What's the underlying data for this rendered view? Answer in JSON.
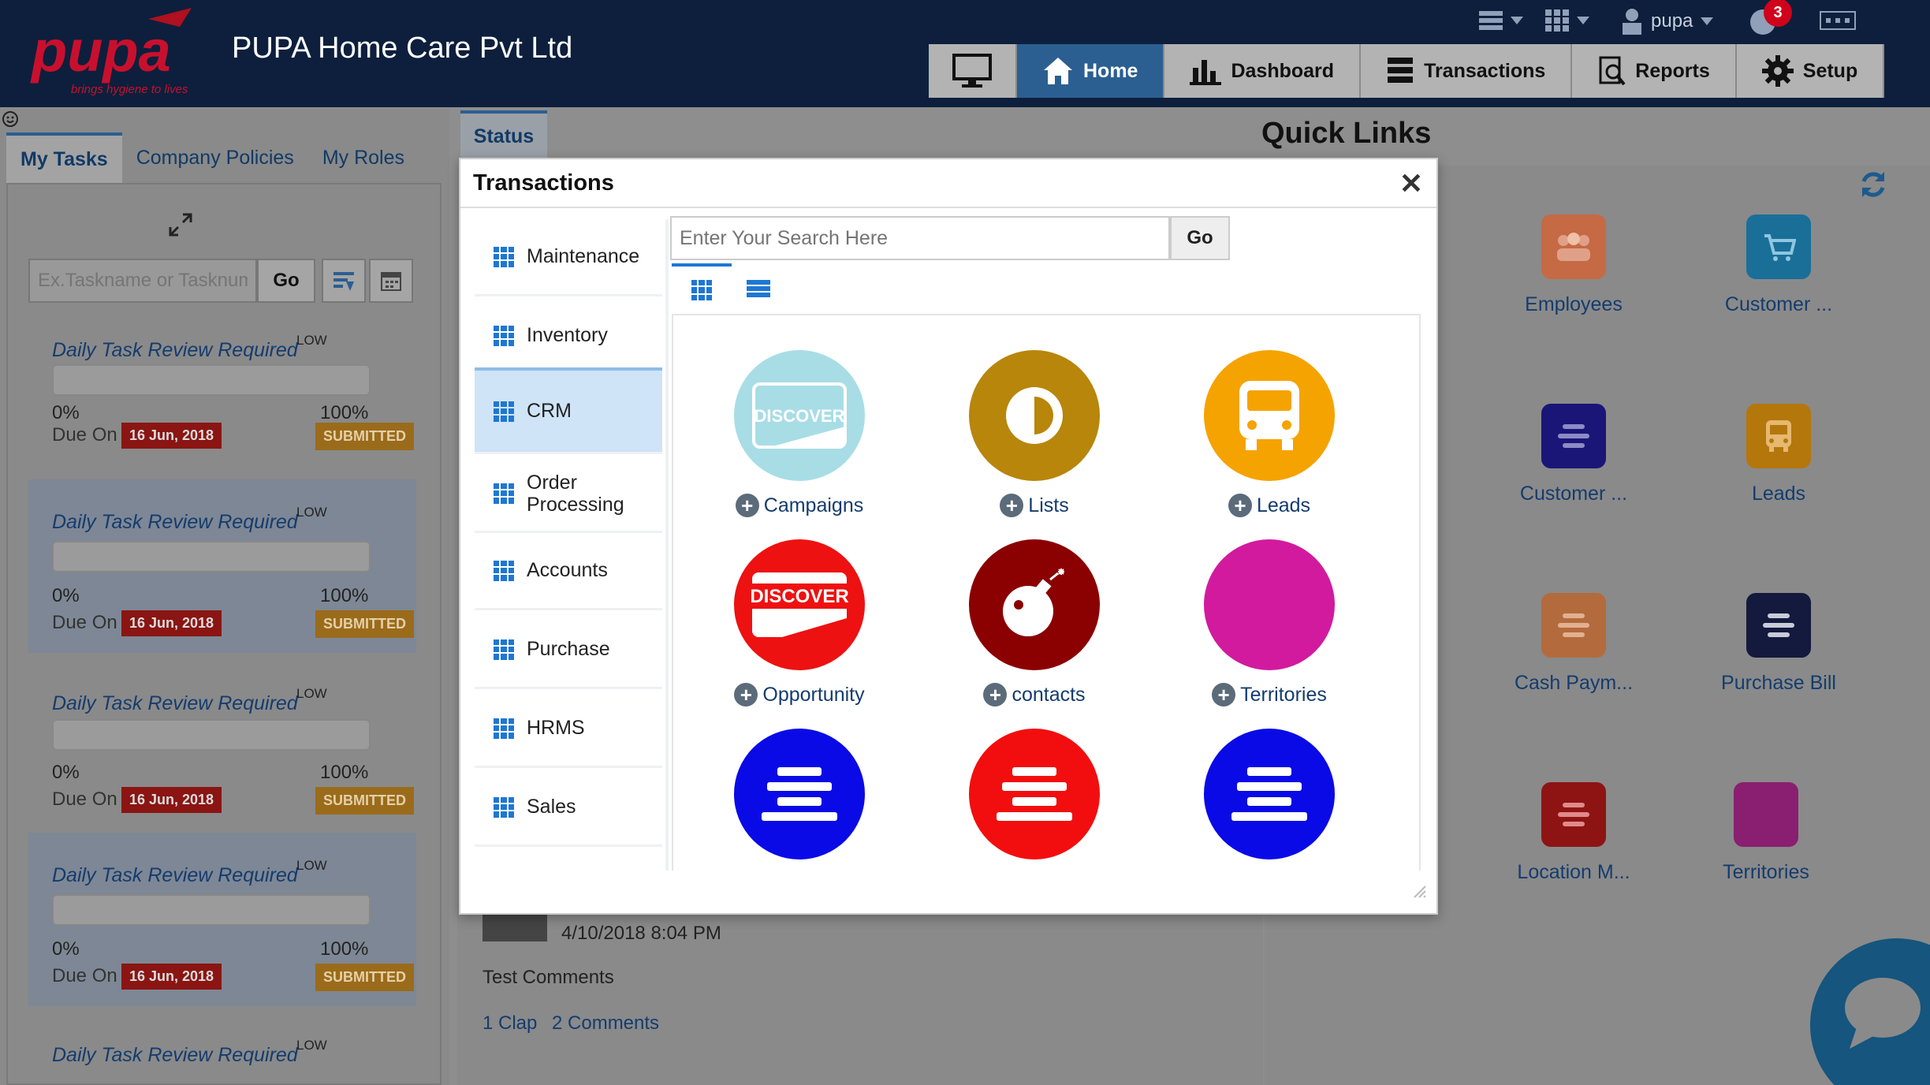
{
  "header": {
    "brand_logo_text": "pupa",
    "brand_tagline": "brings hygiene to lives",
    "company_name": "PUPA Home Care Pvt Ltd",
    "user_name": "pupa",
    "notification_count": "3",
    "nav": [
      {
        "label": "",
        "icon": "monitor-icon"
      },
      {
        "label": "Home",
        "icon": "home-icon"
      },
      {
        "label": "Dashboard",
        "icon": "bar-chart-icon"
      },
      {
        "label": "Transactions",
        "icon": "stack-icon"
      },
      {
        "label": "Reports",
        "icon": "report-icon"
      },
      {
        "label": "Setup",
        "icon": "gear-icon"
      }
    ],
    "active_nav": "Home"
  },
  "left_panel": {
    "tabs": [
      "My Tasks",
      "Company Policies",
      "My Roles"
    ],
    "active_tab": "My Tasks",
    "search_placeholder": "Ex.Taskname or Tasknumber",
    "go_label": "Go",
    "tasks": [
      {
        "title": "Daily Task Review Required",
        "priority": "LOW",
        "progress_start": "0%",
        "progress_end": "100%",
        "due_label": "Due On",
        "due_date": "16 Jun, 2018",
        "status": "SUBMITTED"
      },
      {
        "title": "Daily Task Review Required",
        "priority": "LOW",
        "progress_start": "0%",
        "progress_end": "100%",
        "due_label": "Due On",
        "due_date": "16 Jun, 2018",
        "status": "SUBMITTED"
      },
      {
        "title": "Daily Task Review Required",
        "priority": "LOW",
        "progress_start": "0%",
        "progress_end": "100%",
        "due_label": "Due On",
        "due_date": "16 Jun, 2018",
        "status": "SUBMITTED"
      },
      {
        "title": "Daily Task Review Required",
        "priority": "LOW",
        "progress_start": "0%",
        "progress_end": "100%",
        "due_label": "Due On",
        "due_date": "16 Jun, 2018",
        "status": "SUBMITTED"
      },
      {
        "title": "Daily Task Review Required",
        "priority": "LOW"
      }
    ]
  },
  "center": {
    "status_tab": "Status",
    "feed": {
      "timestamp": "4/10/2018 8:04 PM",
      "comment": "Test Comments",
      "claps": "1 Clap",
      "comments": "2 Comments"
    }
  },
  "quick_links": {
    "title": "Quick Links",
    "items": [
      {
        "label": "Employees",
        "color": "#c56a45",
        "icon": "people-icon"
      },
      {
        "label": "Customer ...",
        "color": "#1a6f98",
        "icon": "cart-icon"
      },
      {
        "label": "Customer ...",
        "color": "#1a1678",
        "icon": "lines-icon"
      },
      {
        "label": "Leads",
        "color": "#b4770c",
        "icon": "bus-icon"
      },
      {
        "label": "Cash Paym...",
        "color": "#b36b3d",
        "icon": "lines-icon"
      },
      {
        "label": "Purchase Bill",
        "color": "#131a3d",
        "icon": "lines-icon"
      },
      {
        "label": "Location M...",
        "color": "#8e1414",
        "icon": "lines-icon"
      },
      {
        "label": "Territories",
        "color": "#8a1e70",
        "icon": "blank-icon"
      }
    ]
  },
  "modal": {
    "title": "Transactions",
    "search_placeholder": "Enter Your Search Here",
    "go_label": "Go",
    "categories": [
      "Maintenance",
      "Inventory",
      "CRM",
      "Order Processing",
      "Accounts",
      "Purchase",
      "HRMS",
      "Sales"
    ],
    "selected_category": "CRM",
    "tiles": [
      {
        "label": "Campaigns",
        "color": "#a8dde6",
        "icon": "discover-card-icon"
      },
      {
        "label": "Lists",
        "color": "#b7860b",
        "icon": "half-circle-icon"
      },
      {
        "label": "Leads",
        "color": "#f5a300",
        "icon": "bus-icon"
      },
      {
        "label": "Opportunity",
        "color": "#ee1111",
        "icon": "discover-card-icon"
      },
      {
        "label": "contacts",
        "color": "#8b0000",
        "icon": "bomb-icon"
      },
      {
        "label": "Territories",
        "color": "#d21a9e",
        "icon": "blank-icon"
      },
      {
        "label": "",
        "color": "#0a0ae6",
        "icon": "lines-icon"
      },
      {
        "label": "",
        "color": "#f20e0e",
        "icon": "lines-icon"
      },
      {
        "label": "",
        "color": "#0a0ae6",
        "icon": "lines-icon"
      }
    ],
    "card_text": "DISCOVER"
  }
}
